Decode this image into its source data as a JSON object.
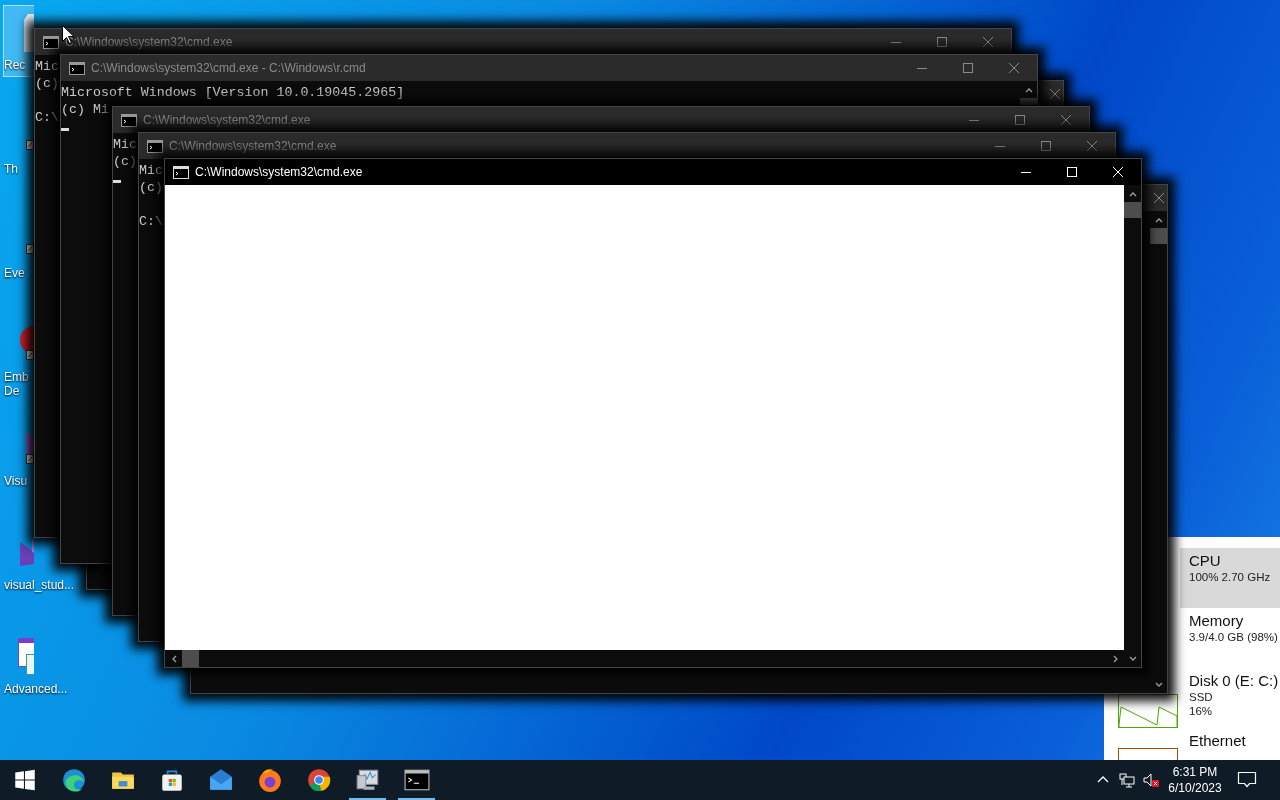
{
  "desktop_icons": [
    {
      "kind": "recycle-bin",
      "label": "Rec",
      "selected": true
    },
    {
      "kind": "shortcut",
      "label": "Th",
      "selected": false
    },
    {
      "kind": "shortcut",
      "label": "Eve",
      "selected": false
    },
    {
      "kind": "red-app",
      "label": "Emb\nDe",
      "selected": false
    },
    {
      "kind": "purple-app",
      "label": "Visu",
      "selected": false
    },
    {
      "kind": "installer",
      "label": "visual_stud...",
      "selected": false
    },
    {
      "kind": "window-app",
      "label": "Advanced...",
      "selected": false
    }
  ],
  "windows": [
    {
      "kind": "console",
      "title": "C:\\Windows\\system32\\cmd.exe",
      "active": false,
      "under_previous": false,
      "lines": [
        {
          "kind": "text",
          "text": "Mic"
        },
        {
          "kind": "text",
          "text": "(c)"
        },
        {
          "kind": "blank"
        },
        {
          "kind": "text",
          "text": "C:\\"
        }
      ]
    },
    {
      "kind": "console",
      "title": "C:\\Windows\\system32\\cmd.exe - C:\\Windows\\r.cmd",
      "active": false,
      "under_previous": false,
      "lines": [
        {
          "kind": "text",
          "text": "Microsoft Windows [Version 10.0.19045.2965]"
        },
        {
          "kind": "text",
          "text": "(c) Mi"
        },
        {
          "kind": "cursor"
        }
      ]
    },
    {
      "kind": "console",
      "under_previous": true
    },
    {
      "kind": "console",
      "title": "C:\\Windows\\system32\\cmd.exe",
      "active": false,
      "under_previous": false,
      "lines": [
        {
          "kind": "text",
          "text": "Mic"
        },
        {
          "kind": "text",
          "text": "(c)"
        },
        {
          "kind": "cursor"
        }
      ]
    },
    {
      "kind": "console",
      "title": "C:\\Windows\\system32\\cmd.exe",
      "active": false,
      "under_previous": false,
      "lines": [
        {
          "kind": "text",
          "text": "Mic"
        },
        {
          "kind": "text",
          "text": "(c)"
        },
        {
          "kind": "blank"
        },
        {
          "kind": "text",
          "text": "C:\\"
        }
      ]
    },
    {
      "kind": "unpainted",
      "title": "C:\\Windows\\system32\\cmd.exe",
      "active": true,
      "under_previous": false
    },
    {
      "kind": "console",
      "under_previous": true
    }
  ],
  "task_manager": {
    "items": [
      {
        "kind": "cpu",
        "name": "CPU",
        "details": [
          "100% 2.70 GHz"
        ],
        "selected": true
      },
      {
        "kind": "memory",
        "name": "Memory",
        "details": [
          "3.9/4.0 GB (98%)"
        ],
        "selected": false
      },
      {
        "kind": "disk",
        "name": "Disk 0 (E: C:)",
        "details": [
          "SSD",
          "16%"
        ],
        "selected": false
      },
      {
        "kind": "ethernet",
        "name": "Ethernet",
        "selected": false
      }
    ]
  },
  "taskbar": {
    "apps": [
      {
        "kind": "edge",
        "running": false
      },
      {
        "kind": "explorer",
        "running": false
      },
      {
        "kind": "store",
        "running": false
      },
      {
        "kind": "mail",
        "running": false
      },
      {
        "kind": "firefox",
        "running": false
      },
      {
        "kind": "chrome",
        "running": false
      },
      {
        "kind": "perfmon",
        "running": true
      },
      {
        "kind": "terminal",
        "running": true
      }
    ],
    "time": "6:31 PM",
    "date": "6/10/2023"
  }
}
